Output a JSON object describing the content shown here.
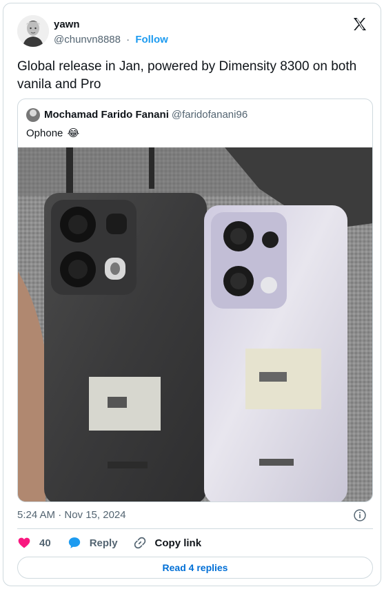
{
  "author": {
    "name": "yawn",
    "handle": "@chunvn8888",
    "separator": "·",
    "follow_label": "Follow"
  },
  "tweet": {
    "text": "Global release in Jan, powered by Dimensity 8300 on both vanila and Pro"
  },
  "quoted_tweet": {
    "author_name": "Mochamad Farido Fanani",
    "author_handle": "@faridofanani96",
    "text": "Ophone",
    "emoji": "😂"
  },
  "meta": {
    "timestamp": "5:24 AM · Nov 15, 2024"
  },
  "actions": {
    "like_count": "40",
    "reply_label": "Reply",
    "copy_link_label": "Copy link"
  },
  "read_replies_label": "Read 4 replies",
  "icons": {
    "logo": "x-logo-icon",
    "info": "info-icon",
    "like": "heart-icon",
    "reply": "speech-bubble-icon",
    "link": "link-icon"
  },
  "colors": {
    "follow": "#1d9bf0",
    "like": "#f91880",
    "reply": "#1d9bf0",
    "read_replies": "#006fd6",
    "border": "#cfd9de",
    "muted": "#536471"
  }
}
